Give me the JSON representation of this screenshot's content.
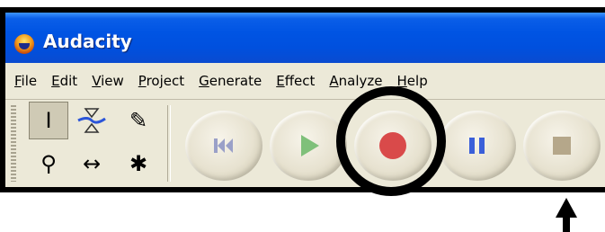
{
  "window": {
    "title": "Audacity"
  },
  "menubar": {
    "items": [
      {
        "key": "F",
        "rest": "ile"
      },
      {
        "key": "E",
        "rest": "dit"
      },
      {
        "key": "V",
        "rest": "iew"
      },
      {
        "key": "P",
        "rest": "roject"
      },
      {
        "key": "G",
        "rest": "enerate"
      },
      {
        "key": "E",
        "rest": "ffect"
      },
      {
        "key": "A",
        "rest": "nalyze"
      },
      {
        "key": "H",
        "rest": "elp"
      }
    ]
  },
  "tools": [
    {
      "name": "selection-tool",
      "icon": "i-beam-icon",
      "glyph": "I",
      "selected": true
    },
    {
      "name": "envelope-tool",
      "icon": "envelope-icon",
      "glyph": "",
      "selected": false
    },
    {
      "name": "draw-tool",
      "icon": "pencil-icon",
      "glyph": "✎",
      "selected": false
    },
    {
      "name": "zoom-tool",
      "icon": "magnifier-icon",
      "glyph": "⚲",
      "selected": false
    },
    {
      "name": "timeshift-tool",
      "icon": "left-right-arrow-icon",
      "glyph": "↔",
      "selected": false
    },
    {
      "name": "multi-tool",
      "icon": "asterisk-icon",
      "glyph": "✱",
      "selected": false
    }
  ],
  "transport": {
    "skip_start": {
      "icon": "skip-to-start-icon",
      "color": "#9aa0c8"
    },
    "play": {
      "icon": "play-icon",
      "color": "#7fc07a"
    },
    "record": {
      "icon": "record-icon",
      "color": "#d94a4a"
    },
    "pause": {
      "icon": "pause-icon",
      "color": "#3a5fd9"
    },
    "stop": {
      "icon": "stop-icon",
      "color": "#b5a78a"
    }
  },
  "annotations": {
    "highlight_ring_color": "#000000",
    "arrow_color": "#000000"
  }
}
